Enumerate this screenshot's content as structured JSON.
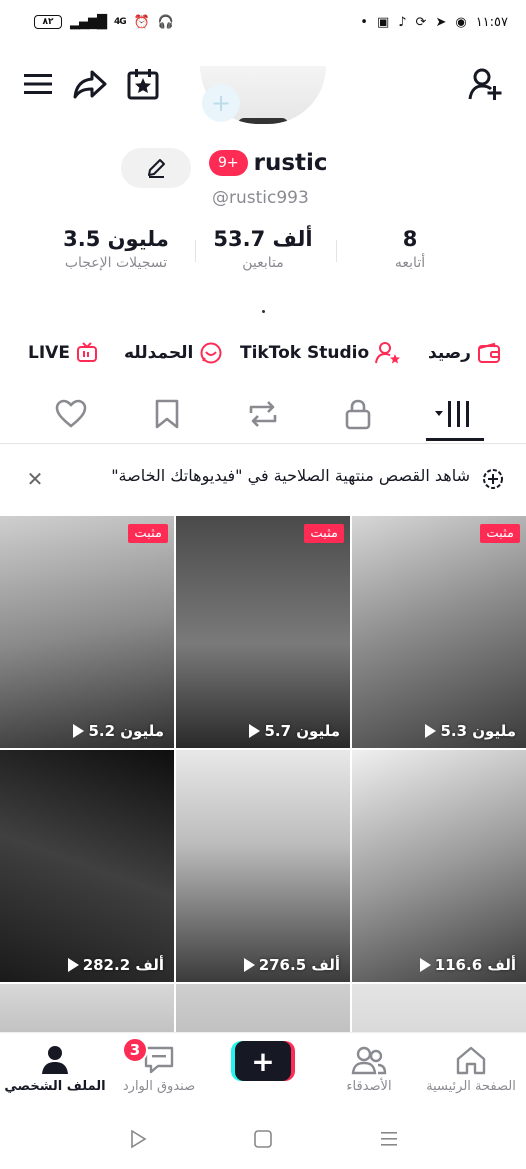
{
  "status_bar": {
    "time": "١١:٥٧",
    "battery": "٨٢",
    "network": "4G"
  },
  "header": {
    "menu_icon": "hamburger-icon",
    "share_icon": "share-arrow-icon",
    "calendar_icon": "star-calendar-icon",
    "add_friend_icon": "add-user-icon"
  },
  "profile": {
    "badge": "9+",
    "name": "rustic",
    "handle": "@rustic993"
  },
  "stats": {
    "likes_value": "3.5 مليون",
    "likes_label": "تسجيلات الإعجاب",
    "followers_value": "53.7 ألف",
    "followers_label": "متابعين",
    "following_value": "8",
    "following_label": "أتابعه"
  },
  "links": {
    "balance": "رصيد",
    "studio": "TikTok Studio",
    "creator": "الحمدلله",
    "live": "LIVE"
  },
  "notice": {
    "text": "شاهد القصص منتهية الصلاحية في \"فيديوهاتك الخاصة\""
  },
  "videos": [
    {
      "views": "5.3 مليون",
      "pinned": "مثبت"
    },
    {
      "views": "5.7 مليون",
      "pinned": "مثبت"
    },
    {
      "views": "5.2 مليون",
      "pinned": "مثبت"
    },
    {
      "views": "116.6 ألف",
      "pinned": ""
    },
    {
      "views": "276.5 ألف",
      "pinned": ""
    },
    {
      "views": "282.2 ألف",
      "pinned": ""
    }
  ],
  "bottom_nav": {
    "home": "الصفحة الرئيسية",
    "friends": "الأصدقاء",
    "inbox": "صندوق الوارد",
    "inbox_badge": "3",
    "profile": "الملف الشخصي"
  },
  "colors": {
    "accent": "#fe2c55",
    "cyan": "#25f4ee",
    "text": "#161823",
    "muted": "#8a8b91"
  }
}
